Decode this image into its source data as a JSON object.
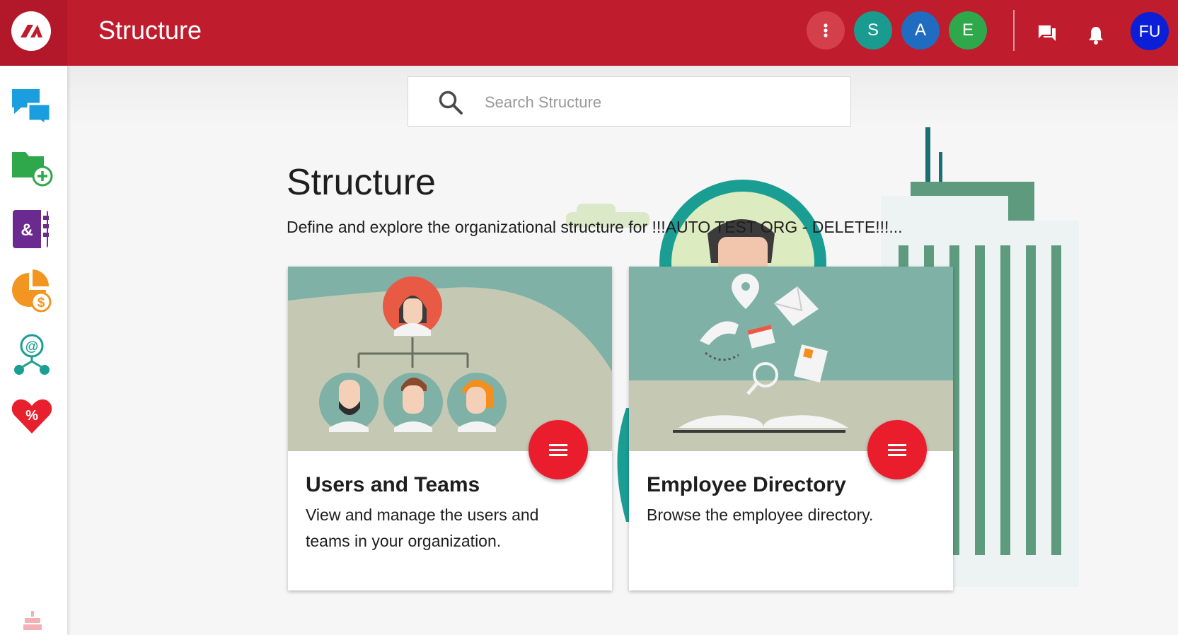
{
  "header": {
    "title": "Structure",
    "avatars": [
      {
        "initial": "S",
        "color": "#1a9b8f"
      },
      {
        "initial": "A",
        "color": "#1f6cc0"
      },
      {
        "initial": "E",
        "color": "#2fa84b"
      }
    ],
    "user_initials": "FU",
    "brand_color": "#bf1c2d",
    "icons": [
      "more-vert-icon",
      "chat-icon",
      "bell-icon"
    ]
  },
  "sidebar": {
    "items": [
      {
        "icon": "chat-bubbles-icon"
      },
      {
        "icon": "folder-add-icon"
      },
      {
        "icon": "ampersand-book-icon"
      },
      {
        "icon": "pie-dollar-icon"
      },
      {
        "icon": "network-at-icon"
      },
      {
        "icon": "heart-percent-icon"
      }
    ],
    "footer_icon": "cake-icon"
  },
  "search": {
    "placeholder": "Search Structure",
    "value": ""
  },
  "main": {
    "title": "Structure",
    "subtitle": "Define and explore the organizational structure for !!!AUTO TEST ORG - DELETE!!!...",
    "cards": [
      {
        "title": "Users and Teams",
        "description": "View and manage the users and teams in your organization.",
        "fab_icon": "menu-icon"
      },
      {
        "title": "Employee Directory",
        "description": "Browse the employee directory.",
        "fab_icon": "menu-icon"
      }
    ]
  }
}
